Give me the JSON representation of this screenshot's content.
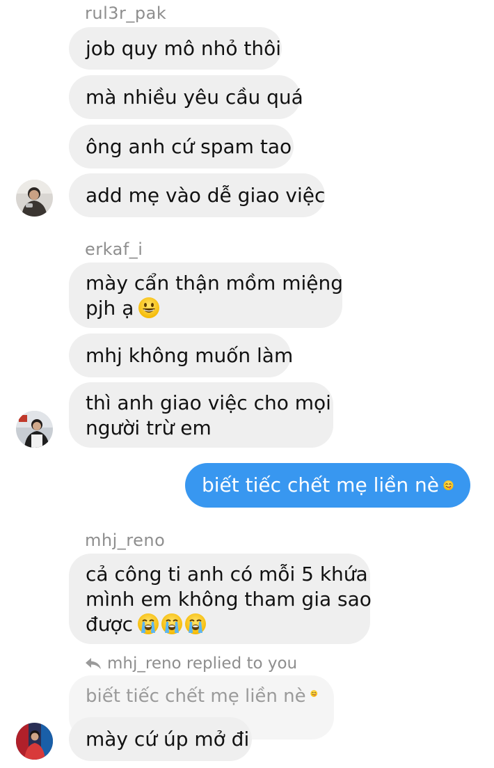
{
  "groups": [
    {
      "sender": "rul3r_pak",
      "messages": [
        "job quy mô nhỏ thôi",
        "mà nhiều yêu cầu quá",
        "ông anh cứ spam tao",
        "add mẹ vào dễ giao việc"
      ]
    },
    {
      "sender": "erkaf_i",
      "messages": [
        [
          "mày cẩn thận mồm miệng",
          "pjh ạ"
        ],
        "mhj không muốn làm",
        [
          "thì anh giao việc cho mọi",
          "người trừ em"
        ]
      ]
    },
    {
      "sender": "mhj_reno",
      "messages": [
        [
          "cả công ti anh có mỗi 5 khứa",
          "mình em không tham gia sao",
          "được"
        ]
      ]
    }
  ],
  "my_message": "biết tiếc chết mẹ liền nè",
  "reply": {
    "note": "mhj_reno replied to you",
    "quoted": "biết tiếc chết mẹ liền nè",
    "message": "mày cứ úp mở đi"
  },
  "colors": {
    "bubble_theirs": "#efefef",
    "bubble_mine": "#3897f0",
    "meta_text": "#8e8e8e"
  },
  "icons": [
    "grinning-emoji",
    "yum-emoji",
    "crying-emoji",
    "reply-arrow-icon"
  ]
}
